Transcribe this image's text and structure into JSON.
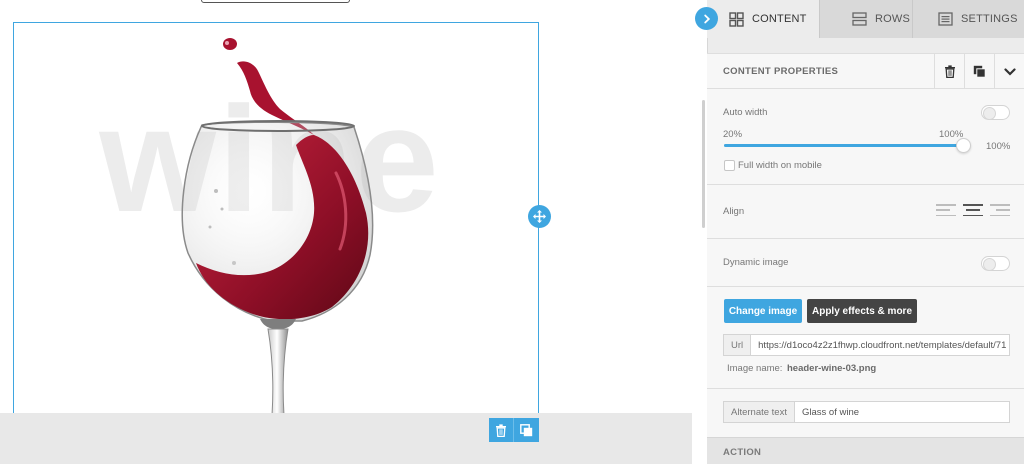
{
  "canvas": {
    "watermark_text": "wine"
  },
  "tabs": [
    {
      "label": "CONTENT",
      "icon": "grid-icon"
    },
    {
      "label": "ROWS",
      "icon": "rows-icon"
    },
    {
      "label": "SETTINGS",
      "icon": "settings-list-icon"
    }
  ],
  "properties": {
    "title": "CONTENT PROPERTIES",
    "auto_width": {
      "label": "Auto width",
      "enabled": false
    },
    "width_slider": {
      "min_label": "20%",
      "max_label": "100%",
      "value_label": "100%",
      "value_fraction": 1.0
    },
    "full_width_mobile": {
      "label": "Full width on mobile",
      "checked": false
    },
    "align": {
      "label": "Align",
      "selected": "center"
    },
    "dynamic_image": {
      "label": "Dynamic image",
      "enabled": false
    },
    "change_image_label": "Change image",
    "apply_effects_label": "Apply effects & more",
    "url": {
      "prefix": "Url",
      "value": "https://d1oco4z2z1fhwp.cloudfront.net/templates/default/71"
    },
    "image_name": {
      "label": "Image name:",
      "value": "header-wine-03.png"
    },
    "alt_text": {
      "prefix": "Alternate text",
      "value": "Glass of wine"
    },
    "action_title": "ACTION"
  },
  "colors": {
    "accent": "#3fa6e0",
    "dark_button": "#444444",
    "wine": "#a8122f"
  }
}
